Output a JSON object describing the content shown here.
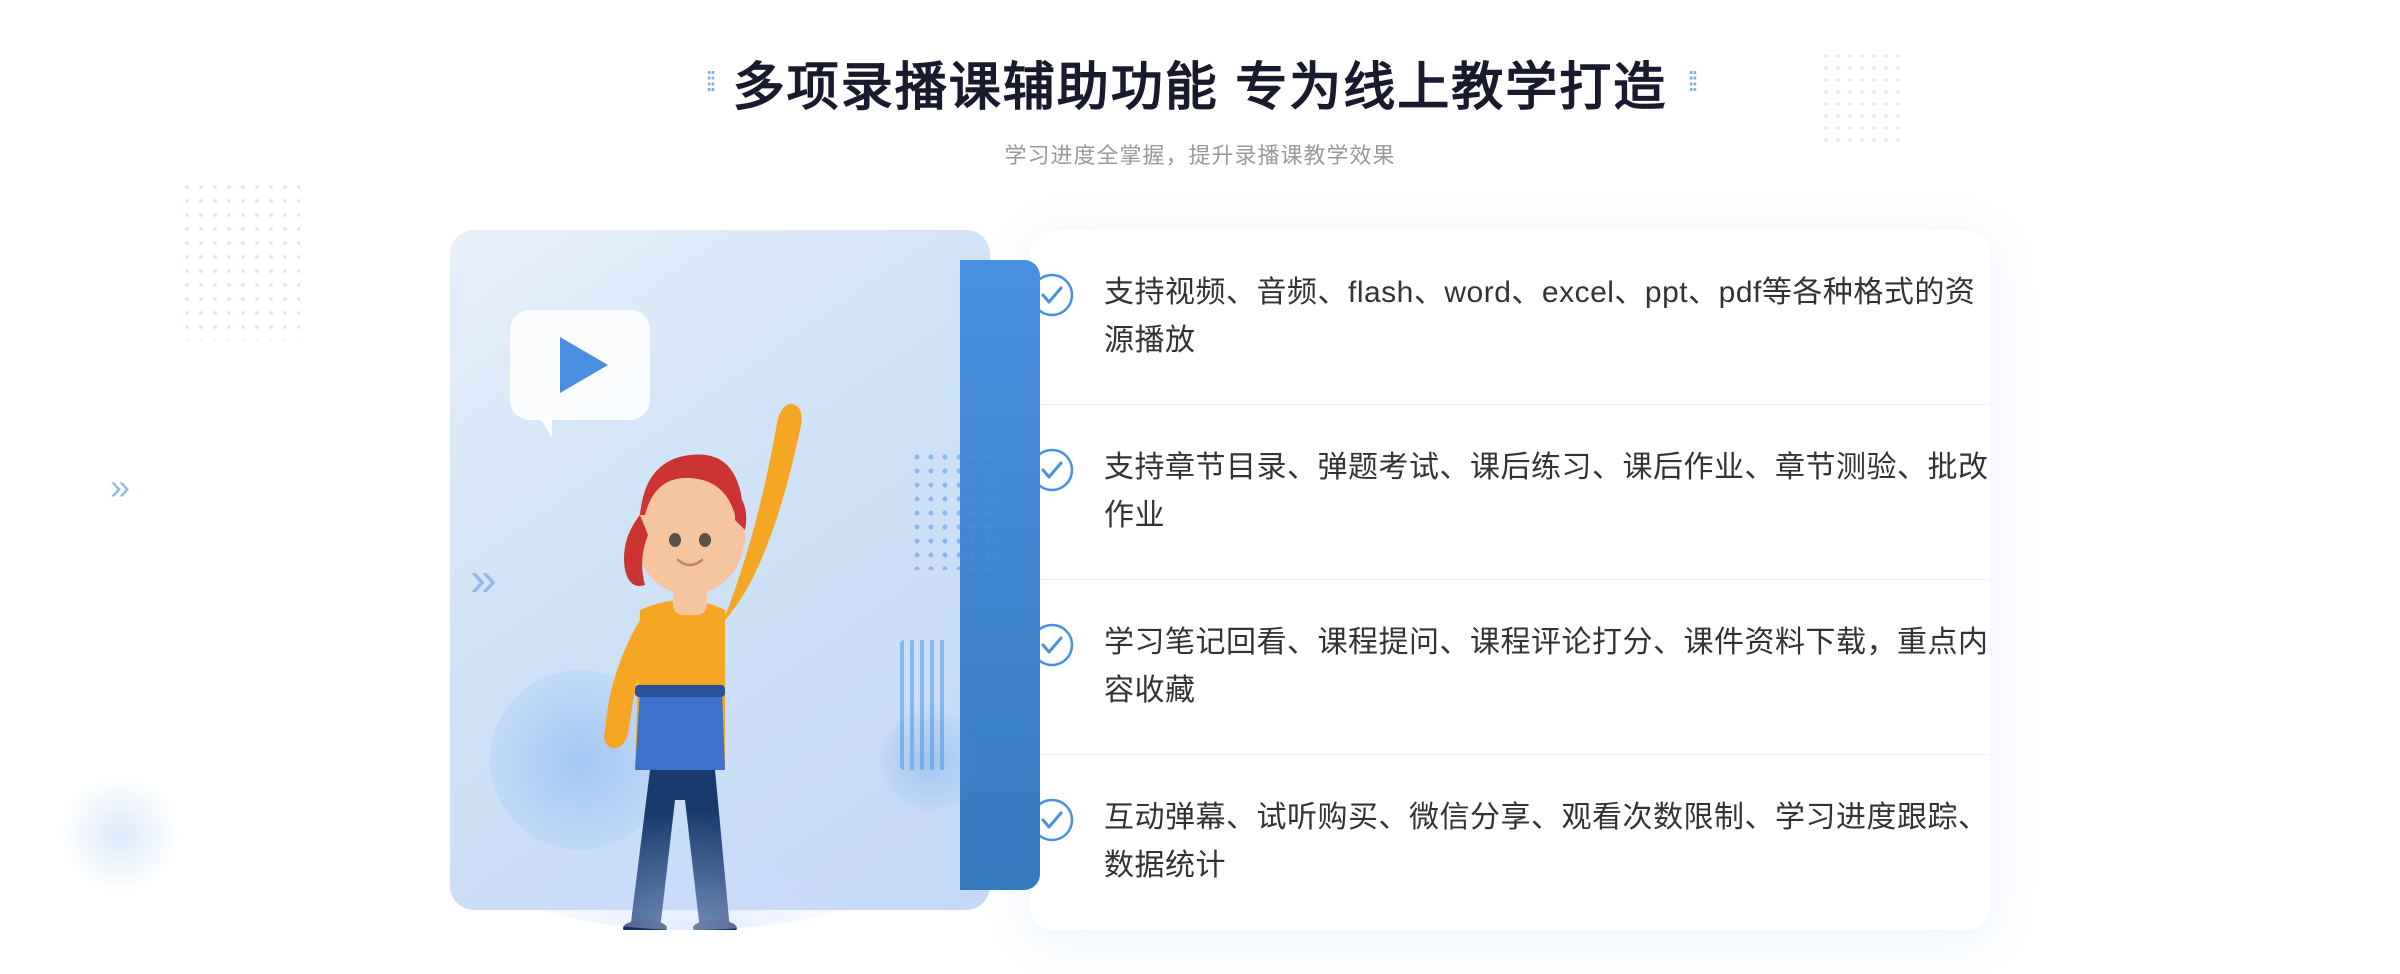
{
  "header": {
    "dots_left": "⁞⁞",
    "dots_right": "⁞⁞",
    "main_title": "多项录播课辅助功能 专为线上教学打造",
    "sub_title": "学习进度全掌握，提升录播课教学效果"
  },
  "features": [
    {
      "id": "feature-1",
      "text": "支持视频、音频、flash、word、excel、ppt、pdf等各种格式的资源播放"
    },
    {
      "id": "feature-2",
      "text": "支持章节目录、弹题考试、课后练习、课后作业、章节测验、批改作业"
    },
    {
      "id": "feature-3",
      "text": "学习笔记回看、课程提问、课程评论打分、课件资料下载，重点内容收藏"
    },
    {
      "id": "feature-4",
      "text": "互动弹幕、试听购买、微信分享、观看次数限制、学习进度跟踪、数据统计"
    }
  ],
  "colors": {
    "accent": "#4a90e2",
    "title": "#1a1a2e",
    "text": "#333333",
    "subtitle": "#999999",
    "bg_illus": "#dce9f8",
    "white": "#ffffff"
  },
  "icons": {
    "check_circle": "check-circle-icon",
    "play": "play-icon",
    "chevron_double": "chevron-double-icon"
  }
}
